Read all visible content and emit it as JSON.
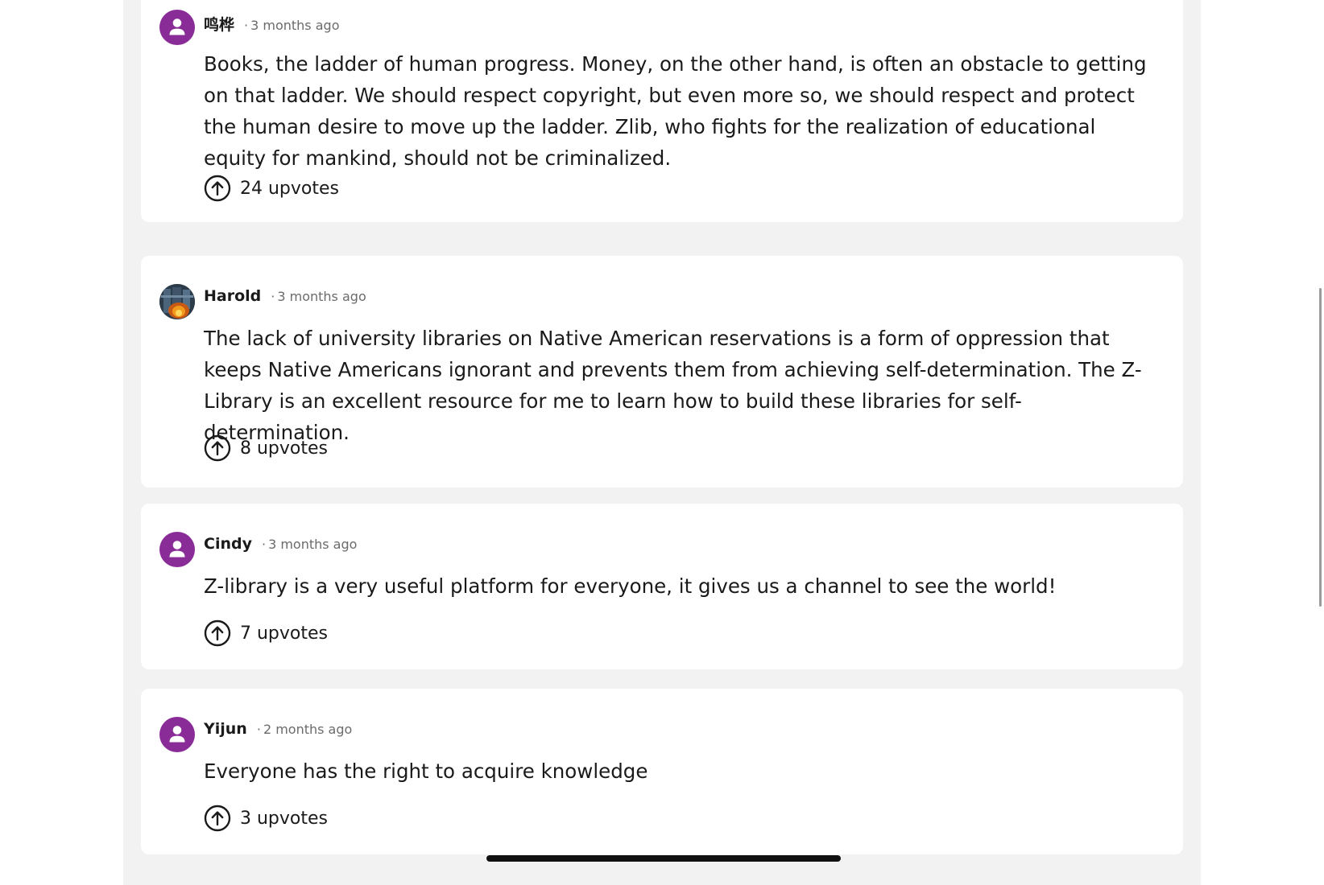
{
  "separator": "·",
  "comments": [
    {
      "author": "鸣桦",
      "time": "3 months ago",
      "avatar_icon": "person-icon",
      "text": "Books, the ladder of human progress. Money, on the other hand, is often an obstacle to getting on that ladder. We should respect copyright, but even more so, we should respect and protect the human desire to move up the ladder. Zlib, who fights for the realization of educational equity for mankind, should not be criminalized.",
      "upvotes": "24 upvotes"
    },
    {
      "author": "Harold",
      "time": "3 months ago",
      "avatar_icon": "user-photo",
      "text": "The lack of university libraries on Native American reservations is a form of oppression that keeps Native Americans ignorant and prevents them from achieving self-determination. The Z-Library is an excellent resource for me to learn how to build these libraries for self-determination.",
      "upvotes": "8 upvotes"
    },
    {
      "author": "Cindy",
      "time": "3 months ago",
      "avatar_icon": "person-icon",
      "text": "Z-library is a very useful platform for everyone, it gives us a channel to see the world!",
      "upvotes": "7 upvotes"
    },
    {
      "author": "Yijun",
      "time": "2 months ago",
      "avatar_icon": "person-icon",
      "text": "Everyone has the right to acquire knowledge",
      "upvotes": "3 upvotes"
    }
  ],
  "colors": {
    "avatar": "#8a2c97",
    "background": "#f2f2f2",
    "card": "#ffffff",
    "text": "#1a1a1a",
    "muted": "#6b6b6b"
  }
}
